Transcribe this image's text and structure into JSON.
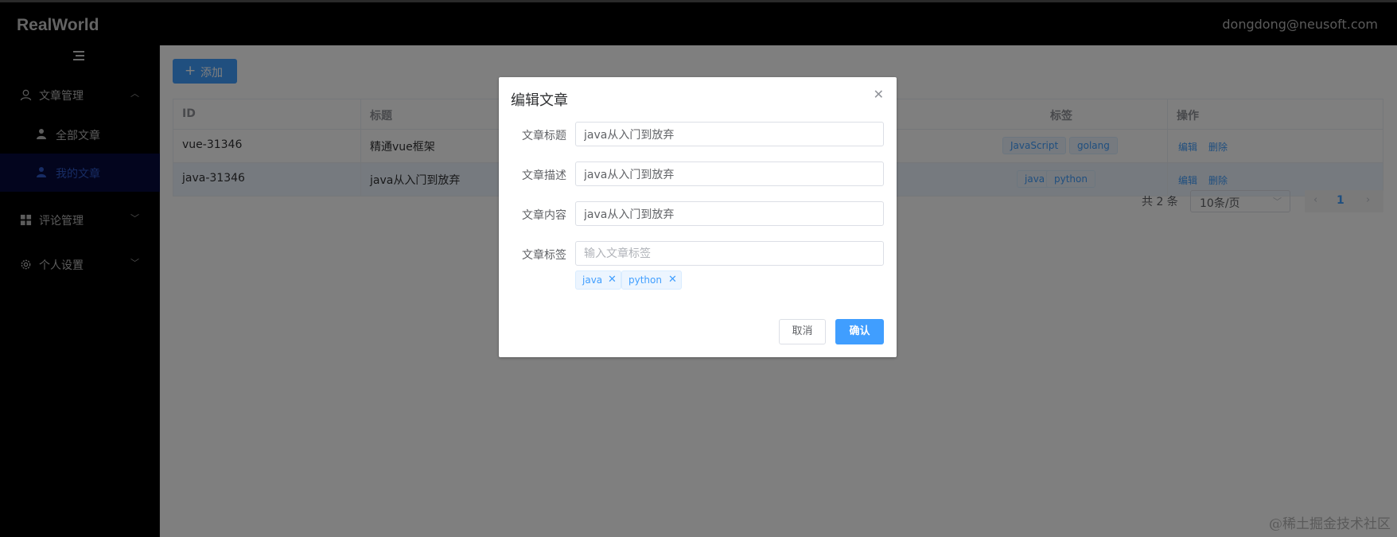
{
  "app": {
    "title": "RealWorld",
    "user_email": "dongdong@neusoft.com"
  },
  "sidebar": {
    "menus": [
      {
        "label": "文章管理",
        "icon": "user-icon",
        "expanded": true
      },
      {
        "label": "评论管理",
        "icon": "grid-icon",
        "expanded": false
      },
      {
        "label": "个人设置",
        "icon": "gear-icon",
        "expanded": false
      }
    ],
    "sub_items": [
      {
        "label": "全部文章",
        "icon": "person-icon",
        "active": false
      },
      {
        "label": "我的文章",
        "icon": "person-icon",
        "active": true
      }
    ]
  },
  "toolbar": {
    "add_label": "添加",
    "add_icon": "plus-icon"
  },
  "table": {
    "headers": {
      "id": "ID",
      "title": "标题",
      "tags": "标签",
      "ops": "操作"
    },
    "rows": [
      {
        "id": "vue-31346",
        "title": "精通vue框架",
        "tags": [
          "JavaScript",
          "golang"
        ],
        "edit": "编辑",
        "delete": "删除"
      },
      {
        "id": "java-31346",
        "title": "java从入门到放弃",
        "tags": [
          "java",
          "python"
        ],
        "edit": "编辑",
        "delete": "删除"
      }
    ]
  },
  "pagination": {
    "total": "共 2 条",
    "page_size": "10条/页",
    "current_page": "1"
  },
  "dialog": {
    "title": "编辑文章",
    "fields": {
      "title_label": "文章标题",
      "title_value": "java从入门到放弃",
      "desc_label": "文章描述",
      "desc_value": "java从入门到放弃",
      "content_label": "文章内容",
      "content_value": "java从入门到放弃",
      "tags_label": "文章标签",
      "tags_placeholder": "输入文章标签"
    },
    "chips": [
      "java",
      "python"
    ],
    "cancel_label": "取消",
    "confirm_label": "确认"
  },
  "watermark": "@稀土掘金技术社区",
  "colors": {
    "primary": "#409eff",
    "sidebar_bg": "#000000",
    "active_item_bg": "#070b3c",
    "overlay": "rgba(0,0,0,0.5)"
  }
}
